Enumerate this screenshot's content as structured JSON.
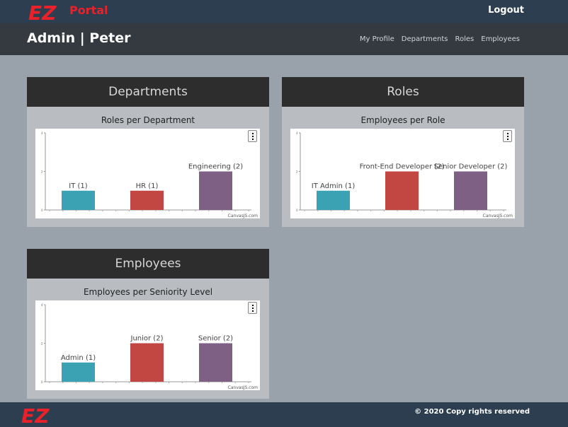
{
  "header": {
    "logo_mark": "EZ",
    "logo_text": "Portal",
    "logout_label": "Logout"
  },
  "subheader": {
    "title": "Admin | Peter",
    "nav": [
      "My Profile",
      "Departments",
      "Roles",
      "Employees"
    ]
  },
  "cards": [
    {
      "header": "Departments",
      "chart_title": "Roles per Department"
    },
    {
      "header": "Roles",
      "chart_title": "Employees per Role"
    },
    {
      "header": "Employees",
      "chart_title": "Employees per Seniority Level"
    }
  ],
  "credit": "CanvasJS.com",
  "colors": {
    "teal": "#3aa2b3",
    "red": "#c24642",
    "purple": "#7f6085",
    "brand_red": "#e8212a"
  },
  "chart_data": [
    {
      "type": "bar",
      "title": "Roles per Department",
      "categories": [
        "IT",
        "HR",
        "Engineering"
      ],
      "values": [
        1,
        1,
        2
      ],
      "labels": [
        "IT (1)",
        "HR (1)",
        "Engineering (2)"
      ],
      "ylim": [
        0,
        4
      ]
    },
    {
      "type": "bar",
      "title": "Employees per Role",
      "categories": [
        "IT Admin",
        "Front-End Developer",
        "Senior Developer"
      ],
      "values": [
        1,
        2,
        2
      ],
      "labels": [
        "IT Admin (1)",
        "Front-End Developer (2)",
        "Senior Developer (2)"
      ],
      "ylim": [
        0,
        4
      ]
    },
    {
      "type": "bar",
      "title": "Employees per Seniority Level",
      "categories": [
        "Admin",
        "Junior",
        "Senior"
      ],
      "values": [
        1,
        2,
        2
      ],
      "labels": [
        "Admin (1)",
        "Junior (2)",
        "Senior (2)"
      ],
      "ylim": [
        0,
        4
      ]
    }
  ],
  "footer": {
    "logo_mark": "EZ",
    "copyright": "© 2020 Copy rights reserved"
  }
}
